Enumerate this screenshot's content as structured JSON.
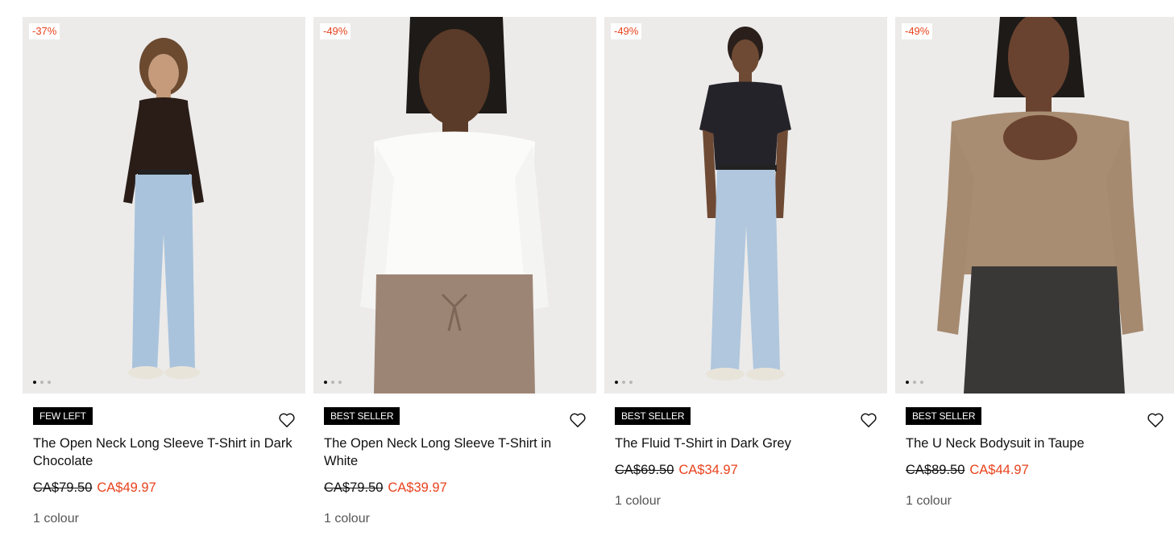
{
  "products": [
    {
      "discount": "-37%",
      "badge": "FEW LEFT",
      "name": "The Open Neck Long Sleeve T-Shirt in Dark Chocolate",
      "price_old": "CA$79.50",
      "price_new": "CA$49.97",
      "colours": "1 colour",
      "top_color": "#2a1d18",
      "bottom_color": "#a9c3dc",
      "shoes_color": "#e9e4da"
    },
    {
      "discount": "-49%",
      "badge": "BEST SELLER",
      "name": "The Open Neck Long Sleeve T-Shirt in White",
      "price_old": "CA$79.50",
      "price_new": "CA$39.97",
      "colours": "1 colour",
      "top_color": "#fbfbfa",
      "bottom_color": "#9d8575",
      "shoes_color": ""
    },
    {
      "discount": "-49%",
      "badge": "BEST SELLER",
      "name": "The Fluid T-Shirt in Dark Grey",
      "price_old": "CA$69.50",
      "price_new": "CA$34.97",
      "colours": "1 colour",
      "top_color": "#25232a",
      "bottom_color": "#b0c7dd",
      "shoes_color": "#e9e4da"
    },
    {
      "discount": "-49%",
      "badge": "BEST SELLER",
      "name": "The U Neck Bodysuit in Taupe",
      "price_old": "CA$89.50",
      "price_new": "CA$44.97",
      "colours": "1 colour",
      "top_color": "#a98d72",
      "bottom_color": "#3a3836",
      "shoes_color": ""
    }
  ],
  "colors": {
    "discount": "#e8421c",
    "badge_bg": "#000000"
  }
}
